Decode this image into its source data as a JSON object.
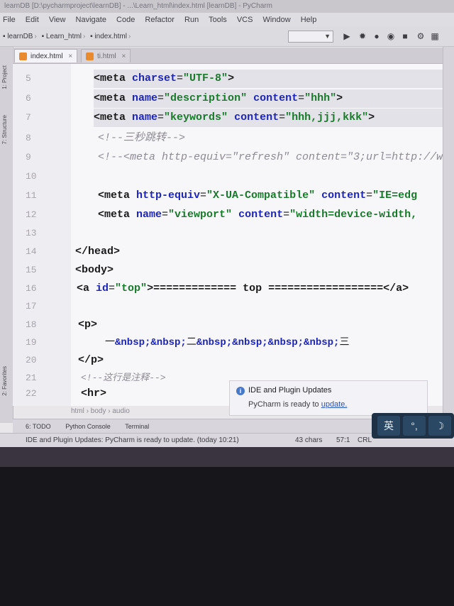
{
  "window": {
    "title": "learnDB [D:\\pycharmproject\\learnDB] - ...\\Learn_html\\index.html [learnDB] - PyCharm"
  },
  "menu": [
    "File",
    "Edit",
    "View",
    "Navigate",
    "Code",
    "Refactor",
    "Run",
    "Tools",
    "VCS",
    "Window",
    "Help"
  ],
  "nav": {
    "crumbs": [
      "learnDB",
      "Learn_html",
      "index.html"
    ]
  },
  "tabs": [
    {
      "label": "index.html",
      "close": "×"
    },
    {
      "label": "ti.html",
      "close": "×"
    }
  ],
  "side_labels": {
    "project": "1: Project",
    "structure": "7: Structure",
    "favorites": "2: Favorites"
  },
  "editor": {
    "line_numbers": [
      "5",
      "6",
      "7",
      "8",
      "9",
      "10",
      "11",
      "12",
      "13",
      "14",
      "15",
      "16",
      "17",
      "18",
      "19",
      "20",
      "21",
      "22"
    ],
    "lines": {
      "l5": {
        "a": "<meta ",
        "b": "charset",
        "c": "=",
        "d": "\"UTF-8\"",
        "e": ">"
      },
      "l6": {
        "a": "<meta ",
        "b": "name",
        "c": "=",
        "d": "\"description\" ",
        "e": "content",
        "f": "=",
        "g": "\"hhh\"",
        "h": ">"
      },
      "l7": {
        "a": "<meta ",
        "b": "name",
        "c": "=",
        "d": "\"keywords\" ",
        "e": "content",
        "f": "=",
        "g": "\"hhh,jjj,kkk\"",
        "h": ">"
      },
      "l8": "<!--三秒跳转-->",
      "l9": "<!--<meta http-equiv=\"refresh\" content=\"3;url=http://ww",
      "l11": {
        "a": "<meta ",
        "b": "http-equiv",
        "c": "=",
        "d": "\"X-UA-Compatible\" ",
        "e": "content",
        "f": "=",
        "g": "\"IE=edg"
      },
      "l12": {
        "a": "<meta ",
        "b": "name",
        "c": "=",
        "d": "\"viewport\" ",
        "e": "content",
        "f": "=",
        "g": "\"width=device-width,"
      },
      "l14": "</head>",
      "l15": "<body>",
      "l16": {
        "a": "<a ",
        "b": "id",
        "c": "=",
        "d": "\"top\"",
        "e": ">============= top ==================</a>"
      },
      "l18": "<p>",
      "l19": {
        "a": "一",
        "b": "&nbsp;&nbsp;",
        "c": "二",
        "d": "&nbsp;&nbsp;&nbsp;&nbsp;",
        "e": "三"
      },
      "l20": "</p>",
      "l21": "<!--这行是注释-->",
      "l22": "<hr>"
    }
  },
  "editor_breadcrumbs": [
    "html",
    "body",
    "audio"
  ],
  "toolwindows": [
    "6: TODO",
    "Python Console",
    "Terminal"
  ],
  "notification": {
    "title": "IDE and Plugin Updates",
    "body": "PyCharm is ready to ",
    "link": "update."
  },
  "status": {
    "message": "IDE and Plugin Updates: PyCharm is ready to update. (today 10:21)",
    "chars": "43 chars",
    "position": "57:1",
    "line_sep": "CRL"
  },
  "ime": {
    "lang": "英",
    "punct": "°,",
    "moon": "☽"
  },
  "colors": {
    "attr": "#1c25b8",
    "value": "#1a7a2c",
    "comment": "#8e8c93"
  }
}
